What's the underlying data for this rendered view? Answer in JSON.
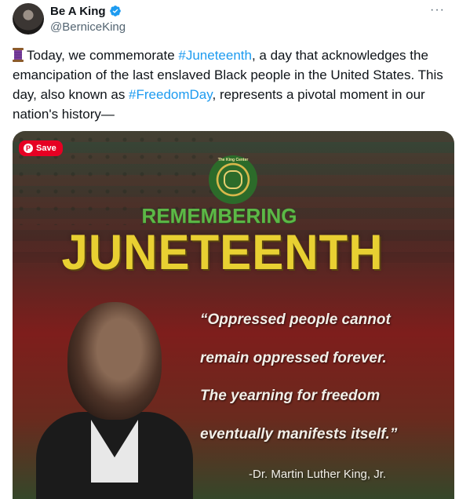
{
  "author": {
    "display_name": "Be A King",
    "handle": "@BerniceKing",
    "verified_icon": "verified-badge-icon",
    "colors": {
      "verified": "#1d9bf0"
    }
  },
  "more_icon": "more-icon",
  "tweet": {
    "emoji": "spool-of-thread-icon",
    "t1": "Today, we commemorate ",
    "tag1": "#Juneteenth",
    "t2": ", a day that acknowledges the emancipation of the last enslaved Black people in the United States. This day, also known as ",
    "tag2": "#FreedomDay",
    "t3": ", represents a pivotal moment in our nation's history—",
    "colors": {
      "hashtag": "#1d9bf0",
      "text": "#0f1419"
    }
  },
  "media": {
    "save_label": "Save",
    "seal_text": "The King Center",
    "remembering": "REMEMBERING",
    "juneteenth": "JUNETEENTH",
    "quote_lines": [
      "“Oppressed people cannot",
      "remain oppressed forever.",
      "The yearning for freedom",
      "eventually manifests itself.”"
    ],
    "attribution": "-Dr. Martin Luther King, Jr.",
    "colors": {
      "remembering": "#5cb846",
      "juneteenth": "#e8d032",
      "save_button": "#e60023"
    }
  }
}
